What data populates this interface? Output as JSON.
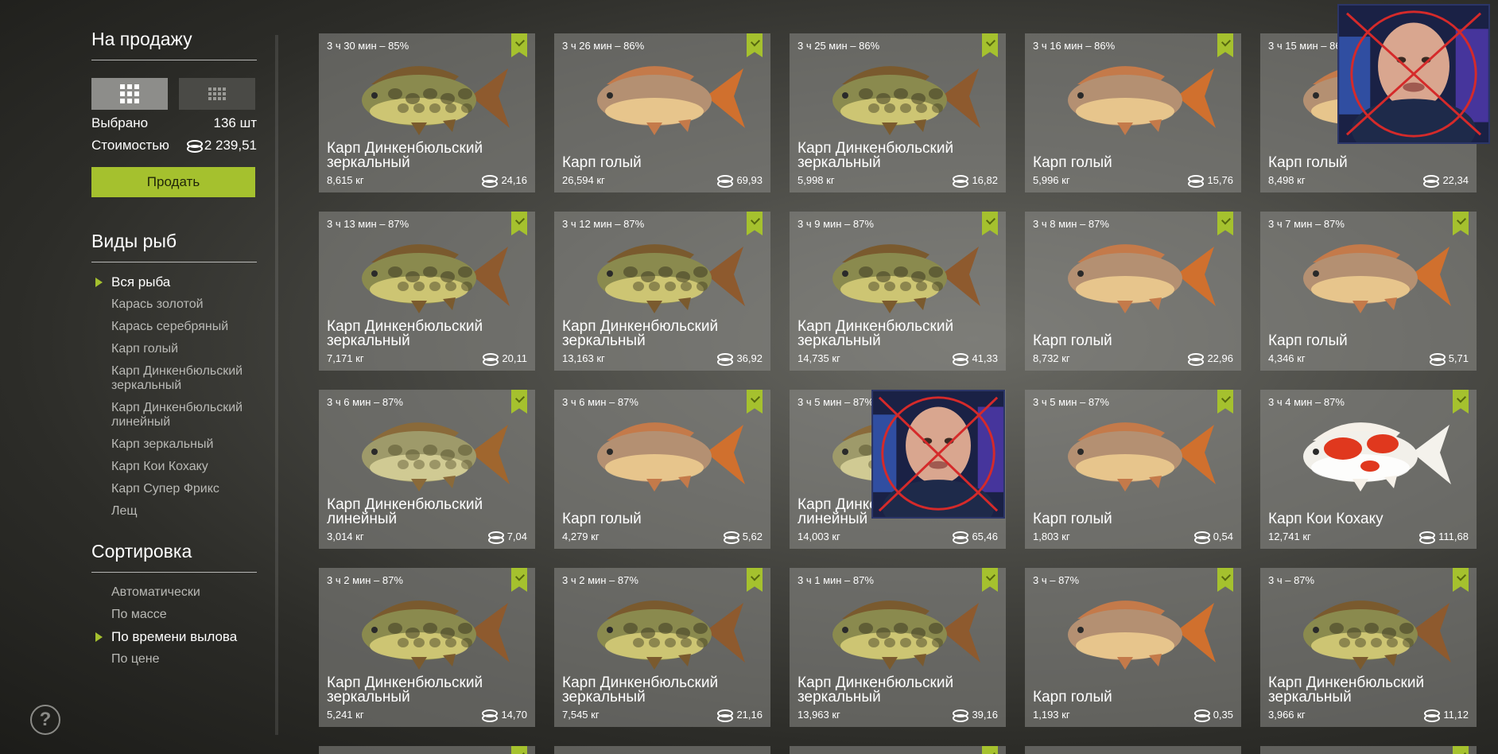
{
  "sidebar": {
    "title": "На продажу",
    "view_modes": [
      "large-grid",
      "small-grid"
    ],
    "selected_label": "Выбрано",
    "selected_value": "136 шт",
    "cost_label": "Стоимостью",
    "cost_value": "2 239,51",
    "sell_label": "Продать",
    "species_title": "Виды рыб",
    "species": [
      {
        "label": "Вся рыба",
        "selected": true
      },
      {
        "label": "Карась золотой"
      },
      {
        "label": "Карась серебряный"
      },
      {
        "label": "Карп голый"
      },
      {
        "label": "Карп Динкенбюльский зеркальный"
      },
      {
        "label": "Карп Динкенбюльский линейный"
      },
      {
        "label": "Карп зеркальный"
      },
      {
        "label": "Карп Кои Кохаку"
      },
      {
        "label": "Карп Супер Фрикс"
      },
      {
        "label": "Лещ"
      }
    ],
    "sort_title": "Сортировка",
    "sort_options": [
      {
        "label": "Автоматически"
      },
      {
        "label": "По массе"
      },
      {
        "label": "По времени вылова",
        "selected": true
      },
      {
        "label": "По цене"
      }
    ],
    "help_icon": "?"
  },
  "colors": {
    "accent": "#a5c12e",
    "card_bg": "#8c8c88"
  },
  "fish_cards": [
    {
      "time": "3 ч 30 мин – 85%",
      "name": "Карп Динкенбюльский зеркальный",
      "weight": "8,615 кг",
      "price": "24,16",
      "fish": "mirror"
    },
    {
      "time": "3 ч 26 мин – 86%",
      "name": "Карп голый",
      "weight": "26,594 кг",
      "price": "69,93",
      "fish": "leather"
    },
    {
      "time": "3 ч 25 мин – 86%",
      "name": "Карп Динкенбюльский зеркальный",
      "weight": "5,998 кг",
      "price": "16,82",
      "fish": "mirror"
    },
    {
      "time": "3 ч 16 мин – 86%",
      "name": "Карп голый",
      "weight": "5,996 кг",
      "price": "15,76",
      "fish": "leather"
    },
    {
      "time": "3 ч 15 мин – 86%",
      "name": "Карп голый",
      "weight": "8,498 кг",
      "price": "22,34",
      "fish": "leather"
    },
    {
      "time": "3 ч 13 мин – 87%",
      "name": "Карп Динкенбюльский зеркальный",
      "weight": "7,171 кг",
      "price": "20,11",
      "fish": "mirror"
    },
    {
      "time": "3 ч 12 мин – 87%",
      "name": "Карп Динкенбюльский зеркальный",
      "weight": "13,163 кг",
      "price": "36,92",
      "fish": "mirror"
    },
    {
      "time": "3 ч 9 мин – 87%",
      "name": "Карп Динкенбюльский зеркальный",
      "weight": "14,735 кг",
      "price": "41,33",
      "fish": "mirror"
    },
    {
      "time": "3 ч 8 мин – 87%",
      "name": "Карп голый",
      "weight": "8,732 кг",
      "price": "22,96",
      "fish": "leather"
    },
    {
      "time": "3 ч 7 мин – 87%",
      "name": "Карп голый",
      "weight": "4,346 кг",
      "price": "5,71",
      "fish": "leather"
    },
    {
      "time": "3 ч 6 мин – 87%",
      "name": "Карп Динкенбюльский линейный",
      "weight": "3,014 кг",
      "price": "7,04",
      "fish": "linear"
    },
    {
      "time": "3 ч 6 мин – 87%",
      "name": "Карп голый",
      "weight": "4,279 кг",
      "price": "5,62",
      "fish": "leather"
    },
    {
      "time": "3 ч 5 мин – 87%",
      "name": "Карп Динкенбюльский линейный",
      "weight": "14,003 кг",
      "price": "65,46",
      "fish": "linear"
    },
    {
      "time": "3 ч 5 мин – 87%",
      "name": "Карп голый",
      "weight": "1,803 кг",
      "price": "0,54",
      "fish": "leather"
    },
    {
      "time": "3 ч 4 мин – 87%",
      "name": "Карп Кои Кохаку",
      "weight": "12,741 кг",
      "price": "111,68",
      "fish": "koi"
    },
    {
      "time": "3 ч 2 мин – 87%",
      "name": "Карп Динкенбюльский зеркальный",
      "weight": "5,241 кг",
      "price": "14,70",
      "fish": "mirror"
    },
    {
      "time": "3 ч 2 мин – 87%",
      "name": "Карп Динкенбюльский зеркальный",
      "weight": "7,545 кг",
      "price": "21,16",
      "fish": "mirror"
    },
    {
      "time": "3 ч 1 мин – 87%",
      "name": "Карп Динкенбюльский зеркальный",
      "weight": "13,963 кг",
      "price": "39,16",
      "fish": "mirror"
    },
    {
      "time": "3 ч – 87%",
      "name": "Карп голый",
      "weight": "1,193 кг",
      "price": "0,35",
      "fish": "leather"
    },
    {
      "time": "3 ч – 87%",
      "name": "Карп Динкенбюльский зеркальный",
      "weight": "3,966 кг",
      "price": "11,12",
      "fish": "mirror"
    }
  ]
}
